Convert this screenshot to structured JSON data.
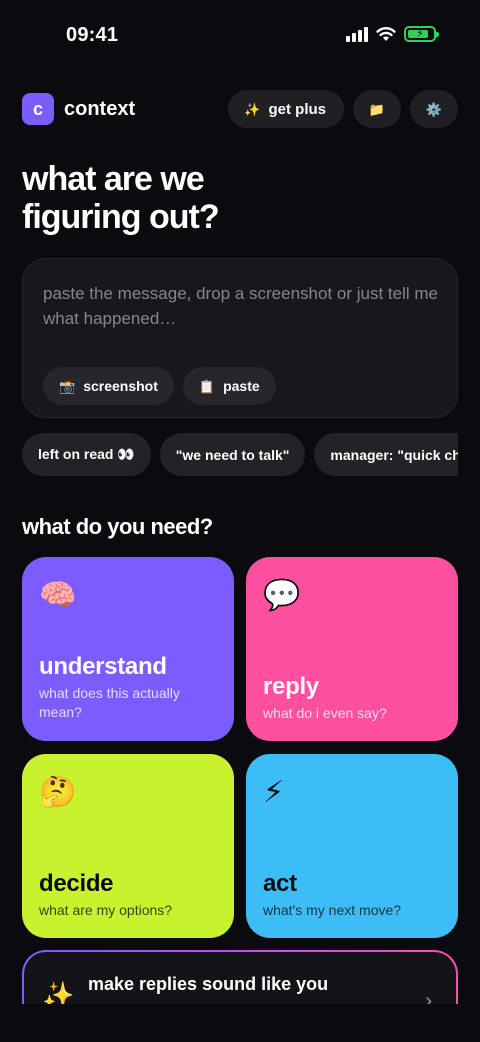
{
  "status_bar": {
    "time": "09:41",
    "icons": [
      "cellular-signal-icon",
      "wifi-icon",
      "battery-charging-icon"
    ],
    "battery_level": 0.85
  },
  "header": {
    "logo_letter": "c",
    "app_name": "context",
    "get_plus": {
      "emoji": "✨",
      "label": "get plus"
    },
    "folder_icon": "📁",
    "settings_icon": "⚙️"
  },
  "title": {
    "line1": "what are we",
    "line2": "figuring out?"
  },
  "input": {
    "placeholder": "paste the message, drop a screenshot or just tell me what happened…",
    "screenshot_button": {
      "emoji": "📸",
      "label": "screenshot"
    },
    "paste_button": {
      "emoji": "📋",
      "label": "paste"
    }
  },
  "suggestions": [
    "left on read 👀",
    "\"we need to talk\"",
    "manager: \"quick chat?\""
  ],
  "section_title": "what do you need?",
  "actions": {
    "understand": {
      "emoji": "🧠",
      "title": "understand",
      "subtitle": "what does this actually mean?",
      "color": "#7c5cff"
    },
    "reply": {
      "emoji": "💬",
      "title": "reply",
      "subtitle": "what do i even say?",
      "color": "#ff4fa0"
    },
    "decide": {
      "emoji": "🤔",
      "title": "decide",
      "subtitle": "what are my options?",
      "color": "#c8f22e"
    },
    "act": {
      "emoji": "⚡",
      "title": "act",
      "subtitle": "what's my next move?",
      "color": "#3dbdf5"
    }
  },
  "promo": {
    "emoji": "✨",
    "label": "make replies sound like you",
    "arrow": "›"
  },
  "colors": {
    "background": "#0b0b0f",
    "surface": "#18181c",
    "accent": "#7c5cff"
  }
}
